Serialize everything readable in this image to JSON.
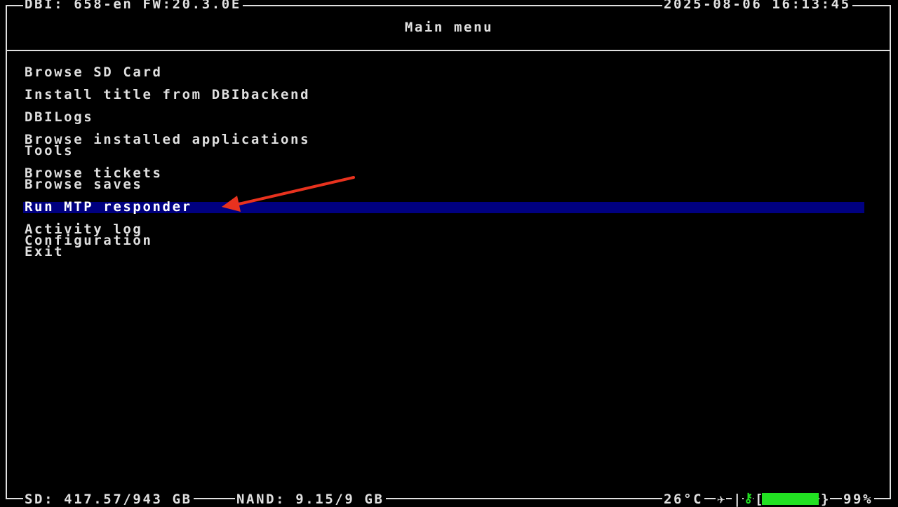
{
  "header": {
    "app_info": "DBI: 658-en FW:20.3.0E",
    "datetime": "2025-08-06 16:13:45",
    "title": "Main menu"
  },
  "menu": {
    "items": [
      {
        "label": "Browse SD Card"
      },
      {
        "label": "Install title from DBIbackend"
      },
      {
        "label": "DBILogs"
      },
      {
        "label": "Browse installed applications"
      },
      {
        "label": "Tools"
      },
      {
        "label": "Browse tickets"
      },
      {
        "label": "Browse saves"
      },
      {
        "label": "Run MTP responder"
      },
      {
        "label": "Activity log"
      },
      {
        "label": "Configuration"
      },
      {
        "label": "Exit"
      }
    ],
    "selected_index": 7
  },
  "footer": {
    "sd": "SD: 417.57/943 GB",
    "nand": "NAND: 9.15/9 GB",
    "temperature": "26°C",
    "airplane_icon": "airplane-icon",
    "separator": "|",
    "key_icon": "key-icon",
    "battery_open": "[",
    "battery_close": "}",
    "battery_percent": "99%",
    "battery_level": 0.99,
    "battery_color": "#22e022"
  },
  "colors": {
    "highlight": "#000080",
    "text": "#e0e0e0",
    "background": "#000000",
    "annotation_arrow": "#e8321e"
  }
}
